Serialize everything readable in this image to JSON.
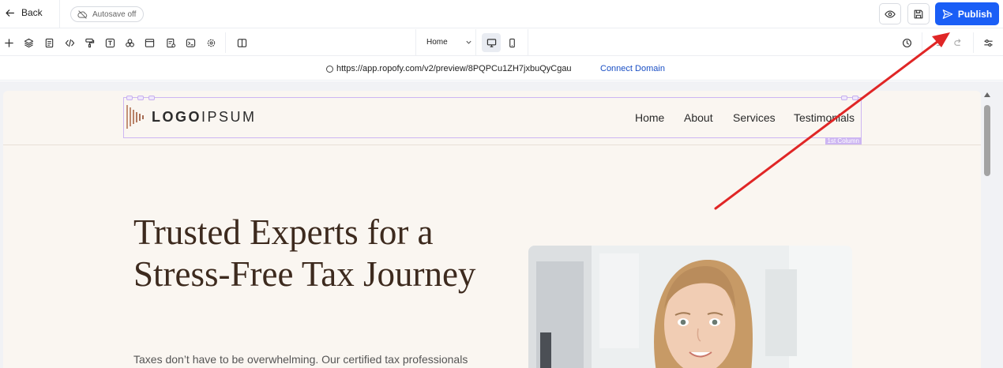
{
  "topbar": {
    "back_label": "Back",
    "autosave_label": "Autosave off",
    "publish_label": "Publish",
    "accent_color": "#1a5ef6"
  },
  "toolbar": {
    "tools": [
      "plus-icon",
      "layers-icon",
      "page-icon",
      "code-icon",
      "paint-roller-icon",
      "text-icon",
      "apps-icon",
      "section-icon",
      "form-icon",
      "terminal-icon",
      "settings-gear-icon",
      "columns-icon"
    ],
    "page_select": "Home",
    "devices": [
      "desktop-icon",
      "mobile-icon"
    ],
    "right_tools": [
      "history-icon",
      "undo-icon",
      "redo-icon",
      "sliders-icon"
    ]
  },
  "urlbar": {
    "url": "https://app.ropofy.com/v2/preview/8PQPCu1ZH7jxbuQyCgau",
    "connect_label": "Connect Domain"
  },
  "site": {
    "logo_bold": "LOGO",
    "logo_light": "IPSUM",
    "column_tag": "1st Column",
    "nav": [
      "Home",
      "About",
      "Services",
      "Testimonials"
    ],
    "hero_title": "Trusted Experts for a Stress-Free Tax Journey",
    "hero_text": "Taxes don’t have to be overwhelming. Our certified tax professionals"
  }
}
